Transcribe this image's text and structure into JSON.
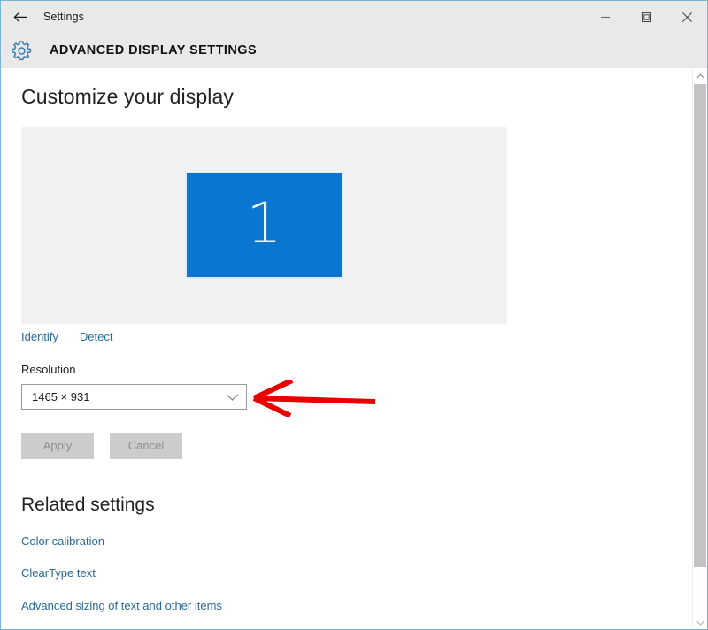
{
  "window": {
    "app_title": "Settings",
    "page_title": "ADVANCED DISPLAY SETTINGS",
    "back_icon": "back-arrow-icon",
    "header_icon": "gear-icon",
    "controls": {
      "minimize": "minimize-icon",
      "maximize": "maximize-icon",
      "close": "close-icon"
    },
    "colors": {
      "titlebar_bg": "#e9e9e9",
      "border": "#7ab3d4",
      "accent_blue": "#0b76cf",
      "link_blue": "#2a6a96",
      "annotation_red": "#e60000"
    }
  },
  "main": {
    "heading": "Customize your display",
    "display_preview": {
      "monitor_number": "1",
      "monitor_color": "#0b76cf",
      "panel_color": "#f2f2f2"
    },
    "actions": [
      {
        "label": "Identify",
        "name": "identify-link"
      },
      {
        "label": "Detect",
        "name": "detect-link"
      }
    ],
    "resolution": {
      "label": "Resolution",
      "value": "1465 × 931",
      "chevron_icon": "chevron-down-icon"
    },
    "buttons": [
      {
        "label": "Apply",
        "name": "apply-button",
        "enabled": false
      },
      {
        "label": "Cancel",
        "name": "cancel-button",
        "enabled": false
      }
    ],
    "related": {
      "heading": "Related settings",
      "links": [
        "Color calibration",
        "ClearType text",
        "Advanced sizing of text and other items"
      ]
    }
  },
  "annotation": {
    "type": "red-left-arrow",
    "color": "#e60000",
    "points_to": "resolution-dropdown"
  },
  "scrollbar": {
    "up_icon": "scroll-up-arrow-icon",
    "down_icon": "scroll-down-arrow-icon",
    "thumb_color": "#c3c3c3"
  }
}
